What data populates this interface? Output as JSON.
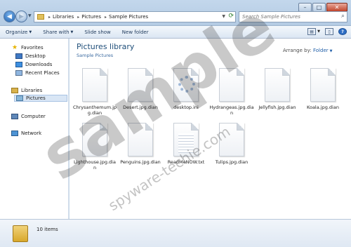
{
  "address": {
    "crumbs": [
      "Libraries",
      "Pictures",
      "Sample Pictures"
    ],
    "separator": "▸"
  },
  "search": {
    "placeholder": "Search Sample Pictures"
  },
  "toolbar": {
    "organize": "Organize",
    "share_with": "Share with",
    "slide_show": "Slide show",
    "new_folder": "New folder"
  },
  "nav": {
    "favorites": "Favorites",
    "desktop": "Desktop",
    "downloads": "Downloads",
    "recent_places": "Recent Places",
    "libraries": "Libraries",
    "pictures": "Pictures",
    "computer": "Computer",
    "network": "Network"
  },
  "content": {
    "title": "Pictures library",
    "subtitle": "Sample Pictures",
    "arrange_label": "Arrange by:",
    "arrange_value": "Folder"
  },
  "files": [
    {
      "name": "Chrysanthemum.jpg.dian",
      "icon": "generic-file-icon"
    },
    {
      "name": "Desert.jpg.dian",
      "icon": "generic-file-icon"
    },
    {
      "name": "desktop.ini",
      "icon": "settings-file-icon"
    },
    {
      "name": "Hydrangeas.jpg.dian",
      "icon": "generic-file-icon"
    },
    {
      "name": "Jellyfish.jpg.dian",
      "icon": "generic-file-icon"
    },
    {
      "name": "Koala.jpg.dian",
      "icon": "generic-file-icon"
    },
    {
      "name": "Lighthouse.jpg.dian",
      "icon": "generic-file-icon"
    },
    {
      "name": "Penguins.jpg.dian",
      "icon": "generic-file-icon"
    },
    {
      "name": "ReadMeNOW.txt",
      "icon": "text-file-icon"
    },
    {
      "name": "Tulips.jpg.dian",
      "icon": "generic-file-icon"
    }
  ],
  "details": {
    "item_count": "10 items"
  },
  "watermark": {
    "main": "sample",
    "site": "spyware-techie.com"
  }
}
